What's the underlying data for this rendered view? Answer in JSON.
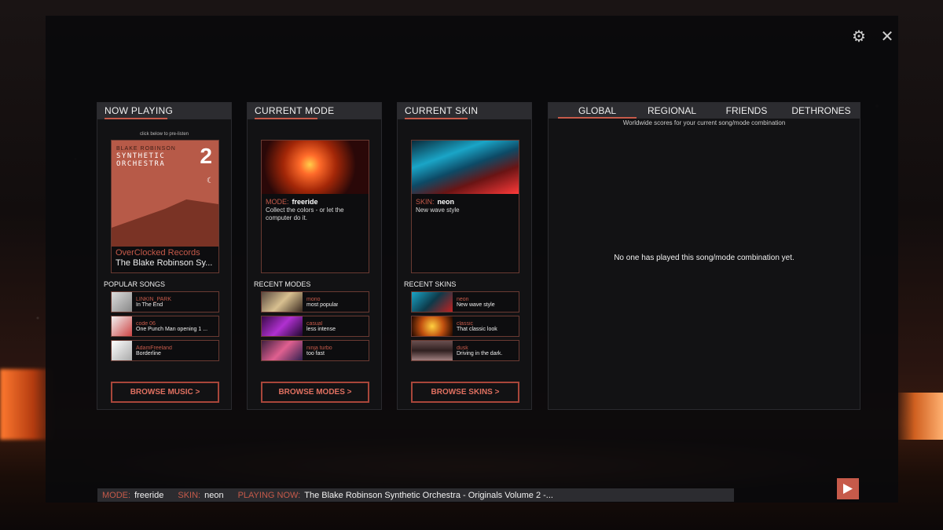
{
  "now_playing": {
    "header": "NOW PLAYING",
    "hint": "click below to pre-listen",
    "album": {
      "artist_line": "BLAKE ROBINSON",
      "title_line": "SYNTHETIC ORCHESTRA",
      "number": "2"
    },
    "label": "OverClocked Records",
    "artist": "The Blake Robinson Sy...",
    "popular_label": "POPULAR SONGS",
    "songs": [
      {
        "artist": "LINKIN_PARK",
        "title": "In The End"
      },
      {
        "artist": "code 06",
        "title": "One Punch Man opening 1 ..."
      },
      {
        "artist": "AdamFreeland",
        "title": "Borderline"
      }
    ],
    "browse": "BROWSE MUSIC >"
  },
  "current_mode": {
    "header": "CURRENT MODE",
    "key": "MODE:",
    "value": "freeride",
    "desc": "Collect the colors - or let the computer do it.",
    "recent_label": "RECENT MODES",
    "modes": [
      {
        "name": "mono",
        "desc": "most popular"
      },
      {
        "name": "casual",
        "desc": "less intense"
      },
      {
        "name": "ninja turbo",
        "desc": "too fast"
      }
    ],
    "browse": "BROWSE MODES >"
  },
  "current_skin": {
    "header": "CURRENT SKIN",
    "key": "SKIN:",
    "value": "neon",
    "desc": "New wave style",
    "recent_label": "RECENT SKINS",
    "skins": [
      {
        "name": "neon",
        "desc": "New wave style"
      },
      {
        "name": "classic",
        "desc": "That classic look"
      },
      {
        "name": "dusk",
        "desc": "Driving in the dark."
      }
    ],
    "browse": "BROWSE SKINS >"
  },
  "scores": {
    "tabs": [
      "GLOBAL",
      "REGIONAL",
      "FRIENDS",
      "DETHRONES"
    ],
    "active_tab": "GLOBAL",
    "desc": "Worldwide scores for your current song/mode combination",
    "empty": "No one has played this song/mode combination yet."
  },
  "status": {
    "mode_key": "MODE:",
    "mode_val": "freeride",
    "skin_key": "SKIN:",
    "skin_val": "neon",
    "playing_key": "PLAYING NOW:",
    "playing_val": "The Blake Robinson Synthetic Orchestra - Originals Volume 2 -..."
  },
  "colors": {
    "accent": "#c65a4a",
    "panel_bg": "#121214",
    "header_bg": "#2c2c30"
  },
  "icons": {
    "settings": "gear-icon",
    "close": "close-icon",
    "play": "play-icon"
  }
}
